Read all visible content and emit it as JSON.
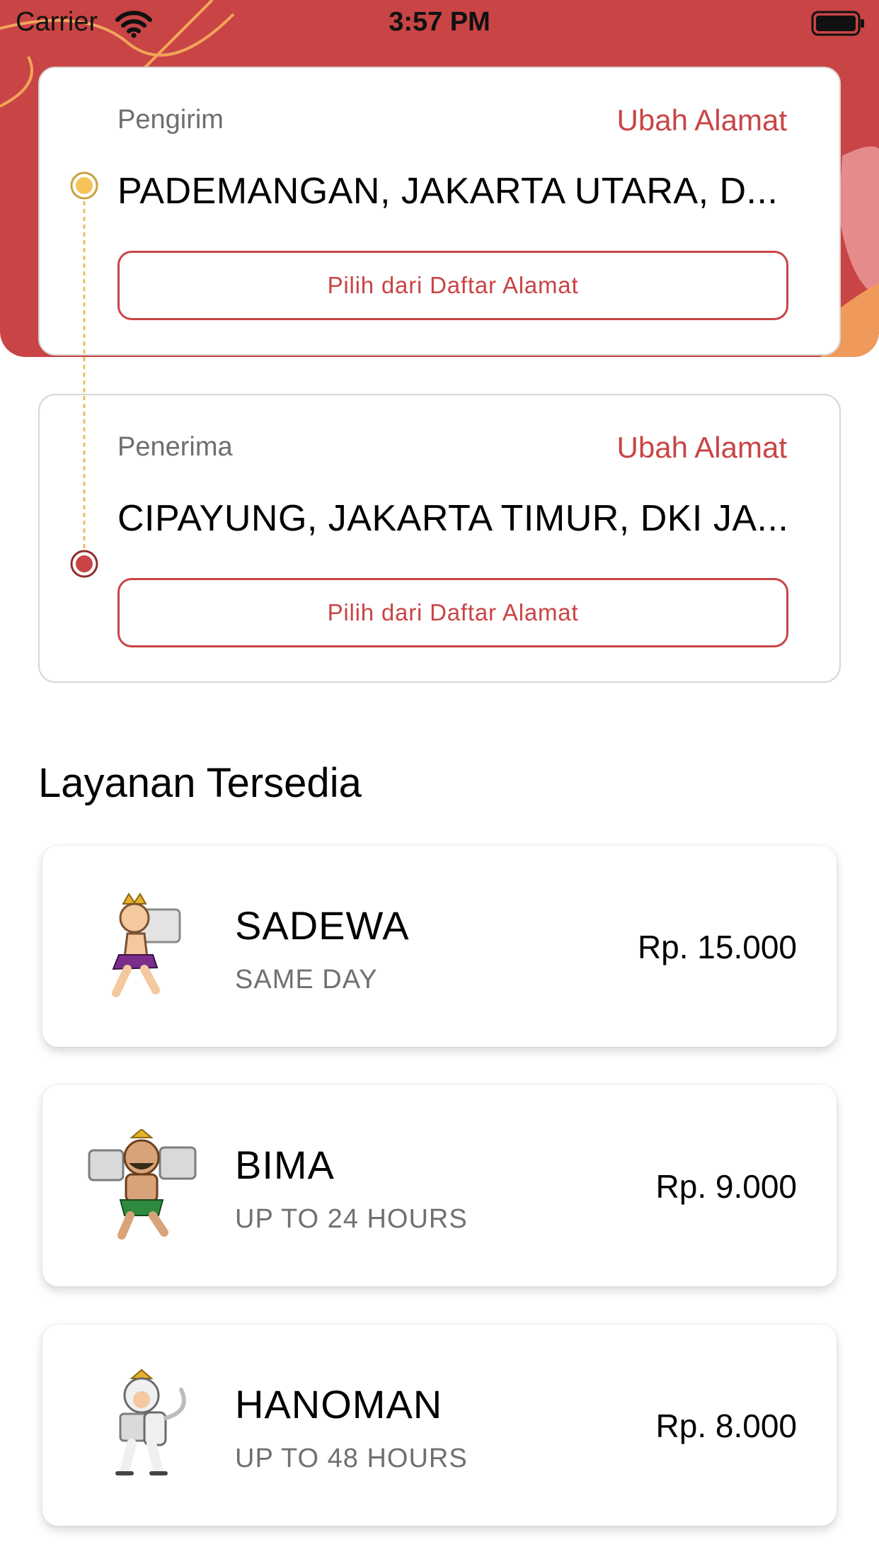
{
  "status_bar": {
    "carrier": "Carrier",
    "time": "3:57 PM"
  },
  "sender": {
    "label": "Pengirim",
    "change_label": "Ubah Alamat",
    "address": "PADEMANGAN, JAKARTA UTARA, D...",
    "pick_label": "Pilih dari Daftar Alamat"
  },
  "receiver": {
    "label": "Penerima",
    "change_label": "Ubah Alamat",
    "address": "CIPAYUNG, JAKARTA TIMUR, DKI JA...",
    "pick_label": "Pilih dari Daftar Alamat"
  },
  "services": {
    "title": "Layanan Tersedia",
    "items": [
      {
        "name": "SADEWA",
        "description": "SAME DAY",
        "price": "Rp. 15.000",
        "icon": "sadewa-mascot-icon"
      },
      {
        "name": "BIMA",
        "description": "UP TO 24 HOURS",
        "price": "Rp. 9.000",
        "icon": "bima-mascot-icon"
      },
      {
        "name": "HANOMAN",
        "description": "UP TO 48 HOURS",
        "price": "Rp. 8.000",
        "icon": "hanoman-mascot-icon"
      }
    ]
  },
  "colors": {
    "brand": "#c94445",
    "origin_dot": "#f6c35a",
    "destination_dot": "#c94445"
  }
}
